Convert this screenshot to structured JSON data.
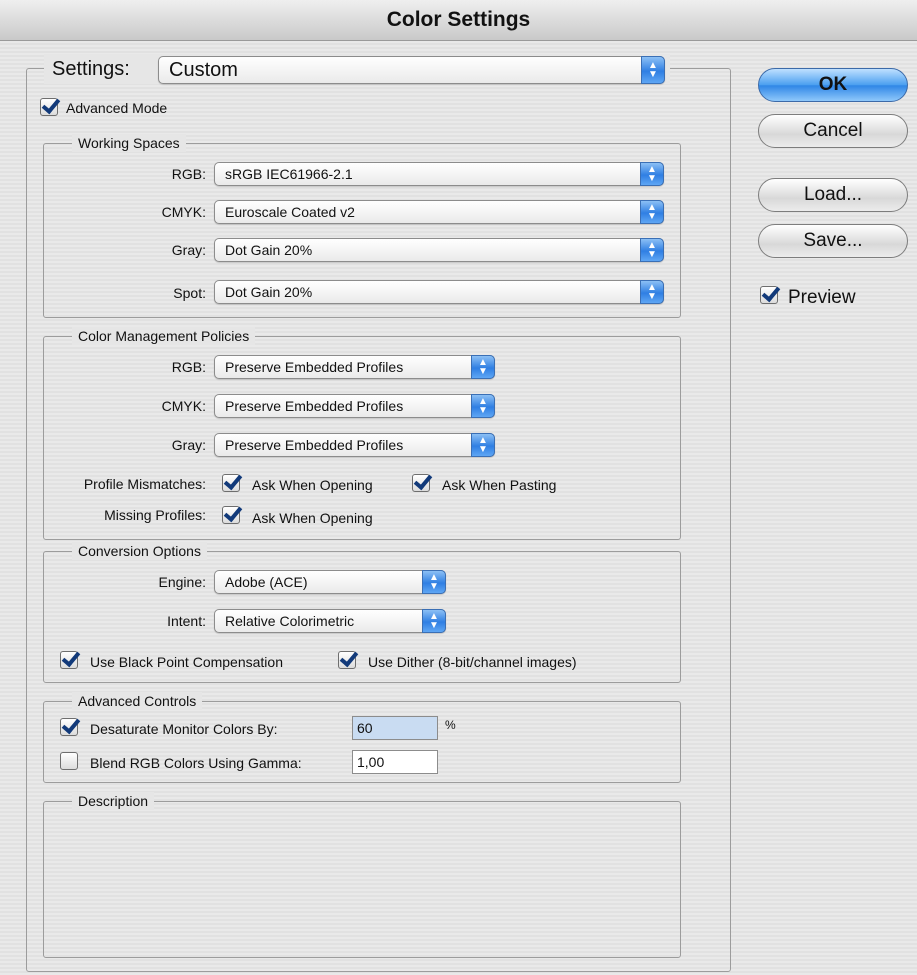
{
  "window": {
    "title": "Color Settings"
  },
  "settings": {
    "label": "Settings:",
    "value": "Custom"
  },
  "advanced_mode": {
    "label": "Advanced Mode",
    "checked": true
  },
  "working_spaces": {
    "title": "Working Spaces",
    "rgb": {
      "label": "RGB:",
      "value": "sRGB IEC61966-2.1"
    },
    "cmyk": {
      "label": "CMYK:",
      "value": "Euroscale Coated v2"
    },
    "gray": {
      "label": "Gray:",
      "value": "Dot Gain 20%"
    },
    "spot": {
      "label": "Spot:",
      "value": "Dot Gain 20%"
    }
  },
  "policies": {
    "title": "Color Management Policies",
    "rgb": {
      "label": "RGB:",
      "value": "Preserve Embedded Profiles"
    },
    "cmyk": {
      "label": "CMYK:",
      "value": "Preserve Embedded Profiles"
    },
    "gray": {
      "label": "Gray:",
      "value": "Preserve Embedded Profiles"
    },
    "profile_mismatches": {
      "label": "Profile Mismatches:",
      "ask_opening": {
        "label": "Ask When Opening",
        "checked": true
      },
      "ask_pasting": {
        "label": "Ask When Pasting",
        "checked": true
      }
    },
    "missing_profiles": {
      "label": "Missing Profiles:",
      "ask_opening": {
        "label": "Ask When Opening",
        "checked": true
      }
    }
  },
  "conversion": {
    "title": "Conversion Options",
    "engine": {
      "label": "Engine:",
      "value": "Adobe (ACE)"
    },
    "intent": {
      "label": "Intent:",
      "value": "Relative Colorimetric"
    },
    "black_point": {
      "label": "Use Black Point Compensation",
      "checked": true
    },
    "dither": {
      "label": "Use Dither (8-bit/channel images)",
      "checked": true
    }
  },
  "advanced_controls": {
    "title": "Advanced Controls",
    "desaturate": {
      "label": "Desaturate Monitor Colors By:",
      "checked": true,
      "value": "60",
      "unit": "%"
    },
    "blend": {
      "label": "Blend RGB Colors Using Gamma:",
      "checked": false,
      "value": "1,00"
    }
  },
  "description": {
    "title": "Description"
  },
  "buttons": {
    "ok": "OK",
    "cancel": "Cancel",
    "load": "Load...",
    "save": "Save..."
  },
  "preview": {
    "label": "Preview",
    "checked": true
  },
  "colors": {
    "accent": "#2f86e6",
    "popup_arrow": "#3a7fe0"
  }
}
